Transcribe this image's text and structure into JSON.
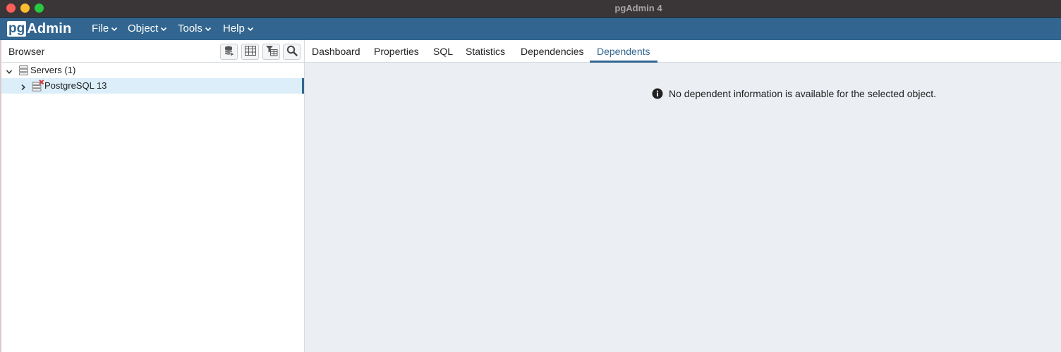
{
  "window": {
    "title": "pgAdmin 4"
  },
  "menubar": {
    "logo_pg": "pg",
    "logo_admin": "Admin",
    "items": [
      {
        "label": "File"
      },
      {
        "label": "Object"
      },
      {
        "label": "Tools"
      },
      {
        "label": "Help"
      }
    ]
  },
  "browser": {
    "title": "Browser",
    "toolbar": [
      {
        "icon": "query-tool-icon"
      },
      {
        "icon": "view-data-icon"
      },
      {
        "icon": "filtered-rows-icon"
      },
      {
        "icon": "search-objects-icon"
      }
    ],
    "tree": [
      {
        "label": "Servers (1)",
        "expanded": true,
        "icon": "server-group-icon"
      },
      {
        "label": "PostgreSQL 13",
        "expanded": false,
        "icon": "server-disconnected-icon",
        "selected": true
      }
    ]
  },
  "tabs": [
    {
      "label": "Dashboard"
    },
    {
      "label": "Properties"
    },
    {
      "label": "SQL"
    },
    {
      "label": "Statistics"
    },
    {
      "label": "Dependencies"
    },
    {
      "label": "Dependents",
      "active": true
    }
  ],
  "main": {
    "message": "No dependent information is available for the selected object.",
    "message_icon": "info-circle-icon"
  },
  "colors": {
    "brand": "#326690",
    "panel_bg": "#ebeef3",
    "selection": "#dbeefa",
    "disconnected": "#d9363e"
  }
}
